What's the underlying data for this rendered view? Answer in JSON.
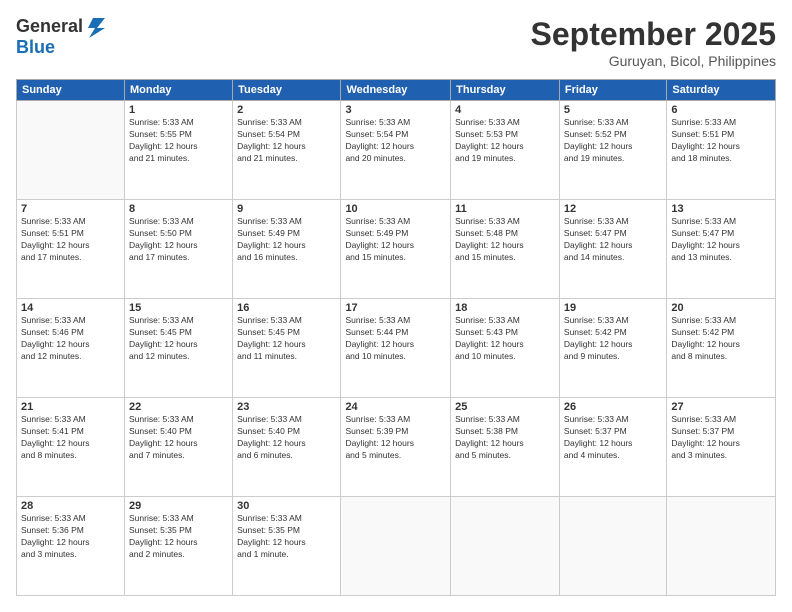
{
  "header": {
    "logo_line1": "General",
    "logo_line2": "Blue",
    "month_title": "September 2025",
    "location": "Guruyan, Bicol, Philippines"
  },
  "days_of_week": [
    "Sunday",
    "Monday",
    "Tuesday",
    "Wednesday",
    "Thursday",
    "Friday",
    "Saturday"
  ],
  "weeks": [
    [
      {
        "day": "",
        "info": ""
      },
      {
        "day": "1",
        "info": "Sunrise: 5:33 AM\nSunset: 5:55 PM\nDaylight: 12 hours\nand 21 minutes."
      },
      {
        "day": "2",
        "info": "Sunrise: 5:33 AM\nSunset: 5:54 PM\nDaylight: 12 hours\nand 21 minutes."
      },
      {
        "day": "3",
        "info": "Sunrise: 5:33 AM\nSunset: 5:54 PM\nDaylight: 12 hours\nand 20 minutes."
      },
      {
        "day": "4",
        "info": "Sunrise: 5:33 AM\nSunset: 5:53 PM\nDaylight: 12 hours\nand 19 minutes."
      },
      {
        "day": "5",
        "info": "Sunrise: 5:33 AM\nSunset: 5:52 PM\nDaylight: 12 hours\nand 19 minutes."
      },
      {
        "day": "6",
        "info": "Sunrise: 5:33 AM\nSunset: 5:51 PM\nDaylight: 12 hours\nand 18 minutes."
      }
    ],
    [
      {
        "day": "7",
        "info": "Sunrise: 5:33 AM\nSunset: 5:51 PM\nDaylight: 12 hours\nand 17 minutes."
      },
      {
        "day": "8",
        "info": "Sunrise: 5:33 AM\nSunset: 5:50 PM\nDaylight: 12 hours\nand 17 minutes."
      },
      {
        "day": "9",
        "info": "Sunrise: 5:33 AM\nSunset: 5:49 PM\nDaylight: 12 hours\nand 16 minutes."
      },
      {
        "day": "10",
        "info": "Sunrise: 5:33 AM\nSunset: 5:49 PM\nDaylight: 12 hours\nand 15 minutes."
      },
      {
        "day": "11",
        "info": "Sunrise: 5:33 AM\nSunset: 5:48 PM\nDaylight: 12 hours\nand 15 minutes."
      },
      {
        "day": "12",
        "info": "Sunrise: 5:33 AM\nSunset: 5:47 PM\nDaylight: 12 hours\nand 14 minutes."
      },
      {
        "day": "13",
        "info": "Sunrise: 5:33 AM\nSunset: 5:47 PM\nDaylight: 12 hours\nand 13 minutes."
      }
    ],
    [
      {
        "day": "14",
        "info": "Sunrise: 5:33 AM\nSunset: 5:46 PM\nDaylight: 12 hours\nand 12 minutes."
      },
      {
        "day": "15",
        "info": "Sunrise: 5:33 AM\nSunset: 5:45 PM\nDaylight: 12 hours\nand 12 minutes."
      },
      {
        "day": "16",
        "info": "Sunrise: 5:33 AM\nSunset: 5:45 PM\nDaylight: 12 hours\nand 11 minutes."
      },
      {
        "day": "17",
        "info": "Sunrise: 5:33 AM\nSunset: 5:44 PM\nDaylight: 12 hours\nand 10 minutes."
      },
      {
        "day": "18",
        "info": "Sunrise: 5:33 AM\nSunset: 5:43 PM\nDaylight: 12 hours\nand 10 minutes."
      },
      {
        "day": "19",
        "info": "Sunrise: 5:33 AM\nSunset: 5:42 PM\nDaylight: 12 hours\nand 9 minutes."
      },
      {
        "day": "20",
        "info": "Sunrise: 5:33 AM\nSunset: 5:42 PM\nDaylight: 12 hours\nand 8 minutes."
      }
    ],
    [
      {
        "day": "21",
        "info": "Sunrise: 5:33 AM\nSunset: 5:41 PM\nDaylight: 12 hours\nand 8 minutes."
      },
      {
        "day": "22",
        "info": "Sunrise: 5:33 AM\nSunset: 5:40 PM\nDaylight: 12 hours\nand 7 minutes."
      },
      {
        "day": "23",
        "info": "Sunrise: 5:33 AM\nSunset: 5:40 PM\nDaylight: 12 hours\nand 6 minutes."
      },
      {
        "day": "24",
        "info": "Sunrise: 5:33 AM\nSunset: 5:39 PM\nDaylight: 12 hours\nand 5 minutes."
      },
      {
        "day": "25",
        "info": "Sunrise: 5:33 AM\nSunset: 5:38 PM\nDaylight: 12 hours\nand 5 minutes."
      },
      {
        "day": "26",
        "info": "Sunrise: 5:33 AM\nSunset: 5:37 PM\nDaylight: 12 hours\nand 4 minutes."
      },
      {
        "day": "27",
        "info": "Sunrise: 5:33 AM\nSunset: 5:37 PM\nDaylight: 12 hours\nand 3 minutes."
      }
    ],
    [
      {
        "day": "28",
        "info": "Sunrise: 5:33 AM\nSunset: 5:36 PM\nDaylight: 12 hours\nand 3 minutes."
      },
      {
        "day": "29",
        "info": "Sunrise: 5:33 AM\nSunset: 5:35 PM\nDaylight: 12 hours\nand 2 minutes."
      },
      {
        "day": "30",
        "info": "Sunrise: 5:33 AM\nSunset: 5:35 PM\nDaylight: 12 hours\nand 1 minute."
      },
      {
        "day": "",
        "info": ""
      },
      {
        "day": "",
        "info": ""
      },
      {
        "day": "",
        "info": ""
      },
      {
        "day": "",
        "info": ""
      }
    ]
  ]
}
